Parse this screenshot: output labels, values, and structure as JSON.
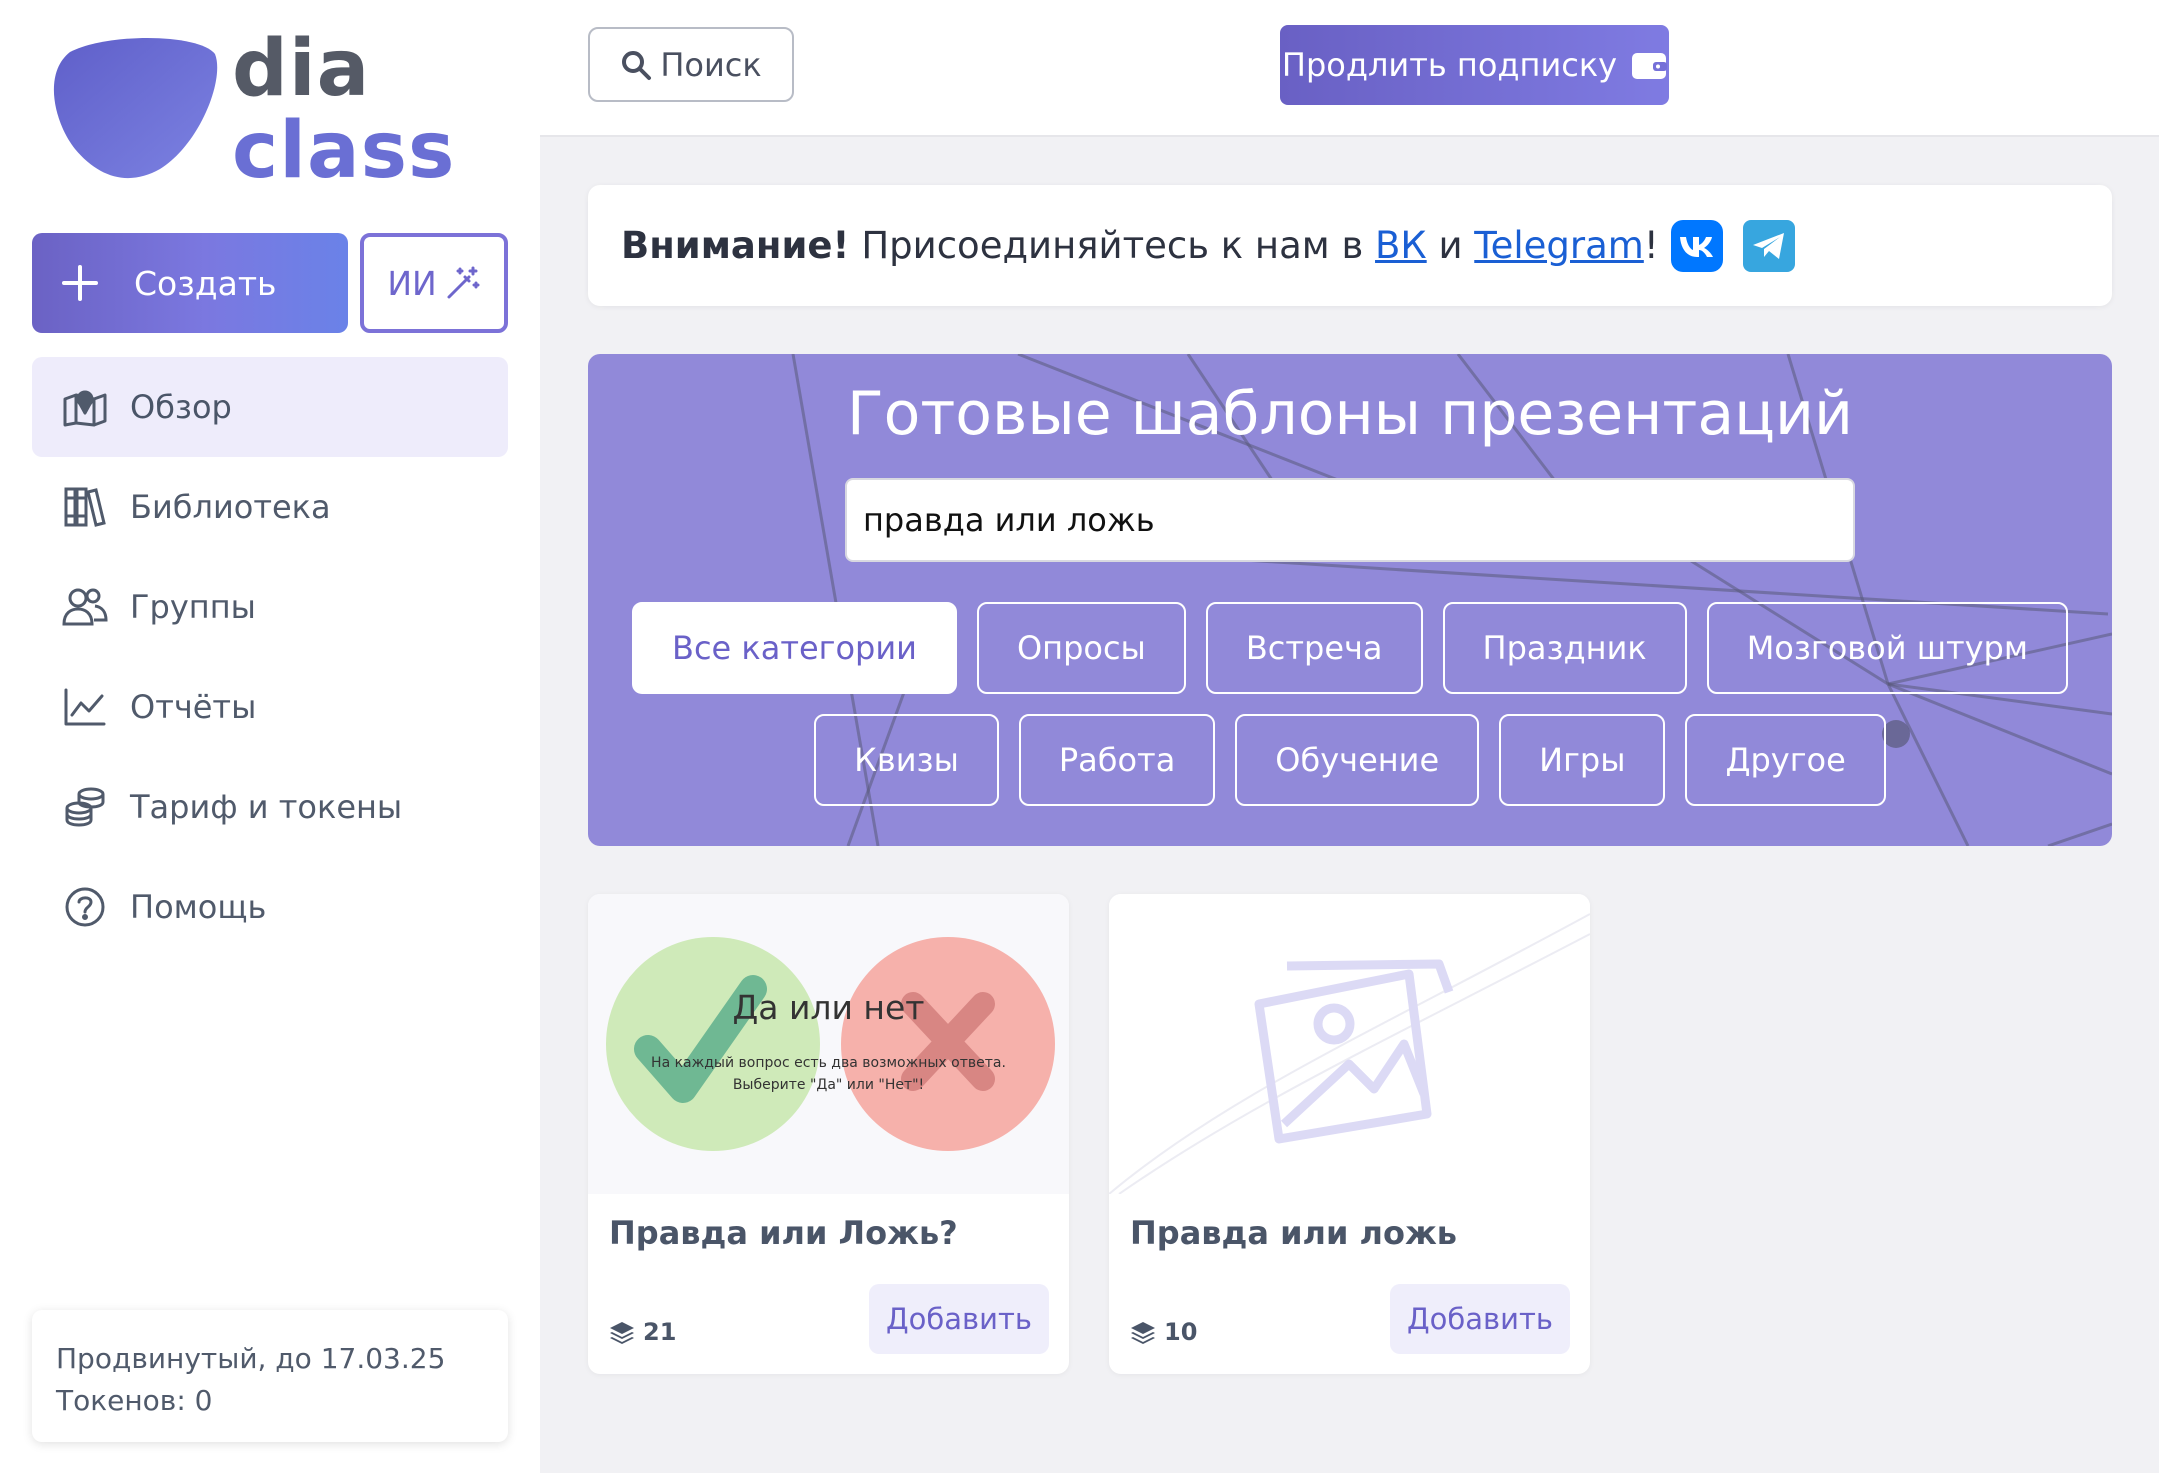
{
  "brand": {
    "line1": "dia",
    "line2": "class",
    "blob_color": "#6a6fd4"
  },
  "sidebar": {
    "create_label": "Создать",
    "ai_label": "ИИ",
    "items": [
      {
        "label": "Обзор",
        "icon": "map-icon",
        "active": true
      },
      {
        "label": "Библиотека",
        "icon": "library-icon"
      },
      {
        "label": "Группы",
        "icon": "users-icon"
      },
      {
        "label": "Отчёты",
        "icon": "chart-line-icon"
      },
      {
        "label": "Тариф и токены",
        "icon": "coins-icon"
      },
      {
        "label": "Помощь",
        "icon": "help-circle-icon"
      }
    ],
    "plan": {
      "line1": "Продвинутый, до 17.03.25",
      "line2": "Токенов: 0"
    }
  },
  "topbar": {
    "search_label": "Поиск",
    "renew_label": "Продлить подписку"
  },
  "notice": {
    "bold": "Внимание!",
    "text": "Присоединяйтесь к нам в",
    "link1": "ВК",
    "and": "и",
    "link2": "Telegram",
    "end": "!"
  },
  "hero": {
    "title": "Готовые шаблоны презентаций",
    "search_value": "правда или ложь",
    "categories_row1": [
      "Все категории",
      "Опросы",
      "Встреча",
      "Праздник",
      "Мозговой штурм"
    ],
    "categories_row2": [
      "Квизы",
      "Работа",
      "Обучение",
      "Игры",
      "Другое"
    ],
    "active_category": "Все категории"
  },
  "templates": [
    {
      "title": "Правда или Ложь?",
      "count": "21",
      "add_label": "Добавить",
      "preview_title": "Да или нет",
      "preview_sub1": "На каждый вопрос есть два возможных ответа.",
      "preview_sub2": "Выберите \"Да\" или \"Нет\"!"
    },
    {
      "title": "Правда или ложь",
      "count": "10",
      "add_label": "Добавить"
    }
  ],
  "colors": {
    "accent": "#7b72d8",
    "hero_bg": "#9189d9",
    "link": "#1a5fd4"
  }
}
